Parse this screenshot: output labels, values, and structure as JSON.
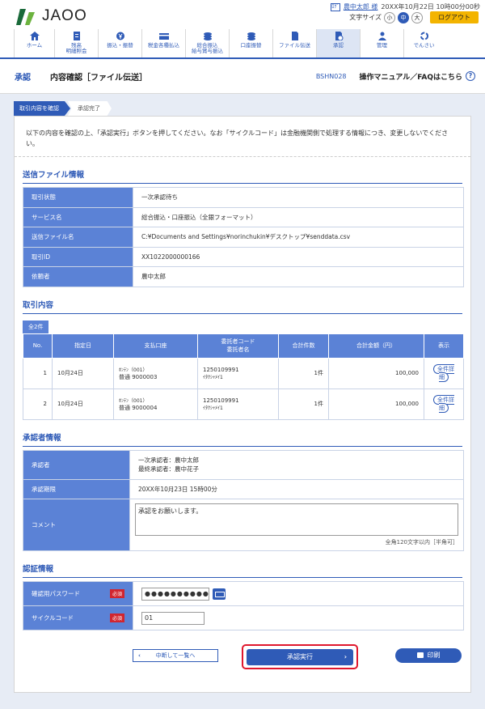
{
  "header": {
    "logo_text": "JAOO",
    "user_icon_text": "ﾛｸﾞ",
    "user_name": "農中太郎 様",
    "login_datetime": "20XX年10月22日 10時00分00秒",
    "font_size_label": "文字サイズ",
    "font_sizes": [
      "小",
      "中",
      "大"
    ],
    "logout_label": "ログアウト"
  },
  "gnav": [
    {
      "label": "ホーム",
      "icon": "home-icon"
    },
    {
      "label": "残高\n明細照会",
      "icon": "document-icon"
    },
    {
      "label": "振込・振替",
      "icon": "yen-icon"
    },
    {
      "label": "税金各種払込",
      "icon": "card-icon"
    },
    {
      "label": "総合振込\n給与賞与振込",
      "icon": "coins-icon"
    },
    {
      "label": "口座振替",
      "icon": "coins-icon"
    },
    {
      "label": "ファイル伝送",
      "icon": "file-icon"
    },
    {
      "label": "承認",
      "icon": "approval-icon"
    },
    {
      "label": "管理",
      "icon": "person-icon"
    },
    {
      "label": "でんさい",
      "icon": "recycle-icon"
    }
  ],
  "titlebar": {
    "section": "承認",
    "title": "内容確認［ファイル伝送］",
    "screen_code": "BSHN028",
    "help": "操作マニュアル／FAQはこちら"
  },
  "steps": [
    "取引内容を確認",
    "承認完了"
  ],
  "intro": "以下の内容を確認の上、「承認実行」ボタンを押してください。なお「サイクルコード」は金融機関側で処理する情報につき、変更しないでください。",
  "send_info": {
    "heading": "送信ファイル情報",
    "rows": [
      {
        "k": "取引状態",
        "v": "一次承認待ち"
      },
      {
        "k": "サービス名",
        "v": "総合振込・口座振込（全銀フォーマット）"
      },
      {
        "k": "送信ファイル名",
        "v": "C:¥Documents and Settings¥norinchukin¥デスクトップ¥senddata.csv"
      },
      {
        "k": "取引ID",
        "v": "XX1022000000166"
      },
      {
        "k": "依頼者",
        "v": "農中太郎"
      }
    ]
  },
  "trans": {
    "heading": "取引内容",
    "count": "全2件",
    "headers": [
      "No.",
      "指定日",
      "支払口座",
      "委託者コード\n委託者名",
      "合計件数",
      "合計金額（円）",
      "表示"
    ],
    "rows": [
      {
        "no": "1",
        "date": "10月24日",
        "acct1": "ﾎﾝﾃﾝ（001）",
        "acct2": "普通 9000003",
        "code": "1250109991",
        "name": "ｲﾀｸｼｬﾒｲ1",
        "count": "1件",
        "amount": "100,000",
        "detail": "全件詳細"
      },
      {
        "no": "2",
        "date": "10月24日",
        "acct1": "ﾎﾝﾃﾝ（001）",
        "acct2": "普通 9000004",
        "code": "1250109991",
        "name": "ｲﾀｸｼｬﾒｲ1",
        "count": "1件",
        "amount": "100,000",
        "detail": "全件詳細"
      }
    ]
  },
  "approver": {
    "heading": "承認者情報",
    "approver_label": "承認者",
    "approver_1": "一次承認者：農中太郎",
    "approver_2": "最終承認者：農中花子",
    "deadline_label": "承認期限",
    "deadline": "20XX年10月23日 15時00分",
    "comment_label": "コメント",
    "comment": "承認をお願いします。",
    "comment_note": "全角120文字以内［半角可］"
  },
  "auth": {
    "heading": "認証情報",
    "pw_label": "確認用パスワード",
    "pw_value": "●●●●●●●●●●",
    "cycle_label": "サイクルコード",
    "cycle_value": "01",
    "required": "必須"
  },
  "buttons": {
    "back": "中断して一覧へ",
    "execute": "承認実行",
    "print": "印刷"
  },
  "colors": {
    "primary": "#2f5bb7",
    "header_cell": "#5b82d6",
    "highlight": "#e0172d",
    "logout": "#f3b400"
  }
}
